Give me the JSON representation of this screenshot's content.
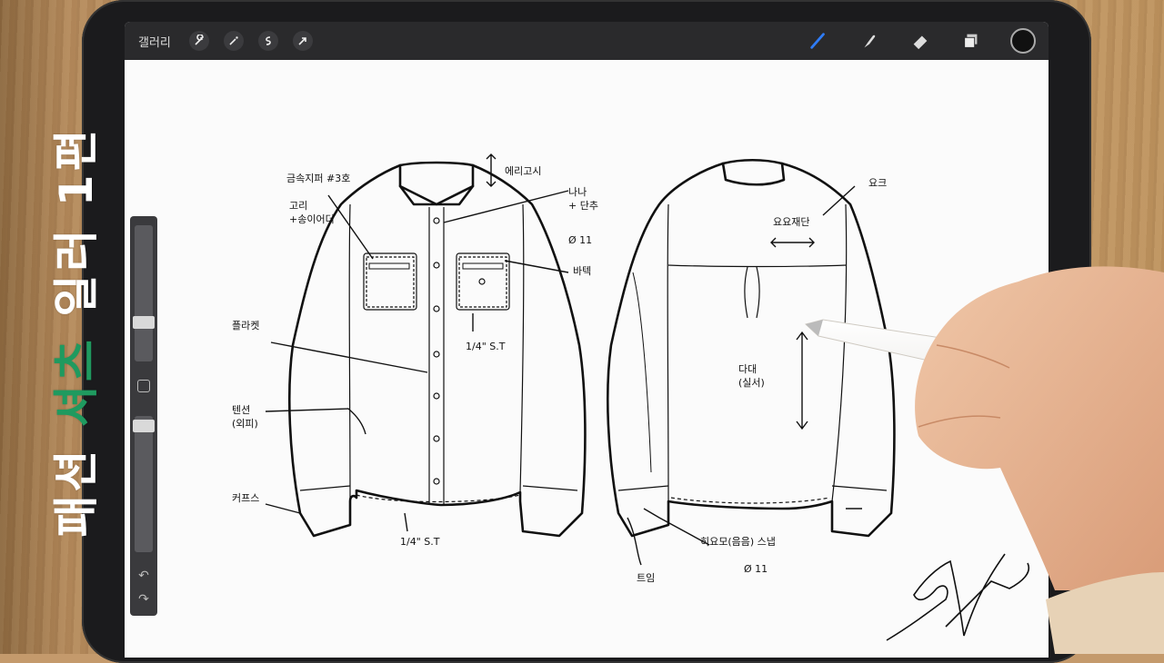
{
  "app": {
    "gallery_label": "갤러리"
  },
  "toolbar_left": [
    {
      "name": "wrench-icon"
    },
    {
      "name": "magic-wand-icon"
    },
    {
      "name": "selection-icon"
    },
    {
      "name": "transform-arrow-icon"
    }
  ],
  "toolbar_right": [
    {
      "name": "brush-icon",
      "active": true
    },
    {
      "name": "smudge-icon"
    },
    {
      "name": "eraser-icon"
    },
    {
      "name": "layers-icon"
    },
    {
      "name": "color-picker-icon"
    }
  ],
  "overlay": {
    "title_part1": "패션 ",
    "title_accent": "셔츠",
    "title_part2": " 일러 1편"
  },
  "annotations": {
    "front": {
      "collar": "에리고시",
      "zipper": "금속지퍼 #3호",
      "pocket_color": "고리\n+송이어더",
      "button": "나나\n+ 단추",
      "button_size": "Ø 11",
      "pocket_stitch": "바텍",
      "placket": "플라켓",
      "stitch_pocket": "1/4\" S.T",
      "side_seam": "텐션\n(외피)",
      "cuffs": "커프스",
      "hem_stitch": "1/4\" S.T"
    },
    "back": {
      "yoke": "요크",
      "yoke_direction": "요요재단",
      "dart": "다대\n(실서)",
      "cuff_button": "히요모(음음) 스냅",
      "cuff_size": "Ø 11",
      "bottom": "트임"
    }
  },
  "colors": {
    "accent": "#1f9a5f",
    "toolbar": "#2a2a2c",
    "active_brush": "#2f7cf6"
  }
}
